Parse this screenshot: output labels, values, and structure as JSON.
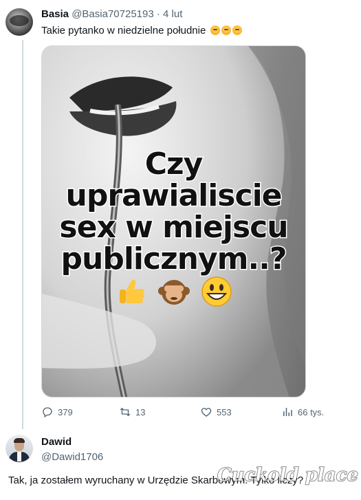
{
  "tweet": {
    "author_name": "Basia",
    "handle": "@Basia70725193",
    "separator": "·",
    "date": "4 lut",
    "text": "Takie pytanko w niedzielne południe",
    "text_emojis": [
      "thinking-face-emoji",
      "thinking-face-emoji",
      "thinking-face-emoji"
    ],
    "media": {
      "overlay_lines": [
        "Czy",
        "uprawialiscie",
        "sex w miejscu",
        "publicznym..?"
      ],
      "overlay_emojis": [
        "thumbs-up-emoji",
        "see-no-evil-monkey-emoji",
        "grinning-face-emoji"
      ]
    },
    "stats": {
      "replies": "379",
      "reposts": "13",
      "likes": "553",
      "views": "66 tys."
    }
  },
  "reply": {
    "author_name": "Dawid",
    "handle": "@Dawid1706",
    "text": "Tak, ja zostałem wyruchany w Urzędzie Skarbowym. Tylko liczy?"
  },
  "watermark": "Cuckold place",
  "colors": {
    "text": "#0f1419",
    "muted": "#536471",
    "border": "#cfd9de"
  }
}
